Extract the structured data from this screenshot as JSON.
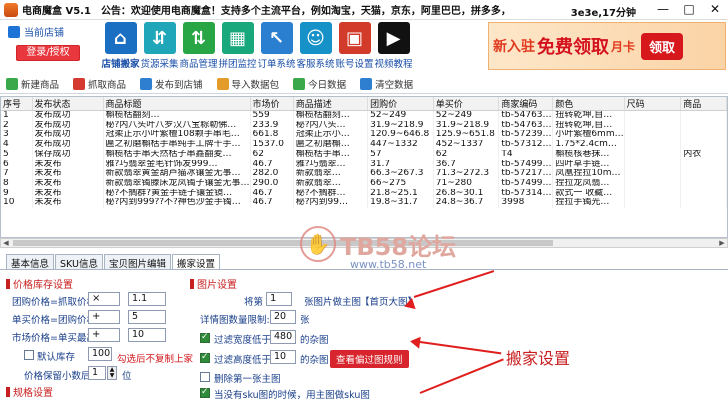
{
  "window": {
    "title": "电商魔盒 V5.1",
    "notice": "公告：欢迎使用电商魔盒！支持多个主流平台，例如淘宝，天猫，京东，阿里巴巴，拼多多，",
    "timer": "3e3e,17分钟"
  },
  "store": {
    "label": "当前店铺",
    "login": "登录/授权"
  },
  "nav": [
    {
      "label": "店铺搬家",
      "color": "#1a6fc3",
      "glyph": "⌂"
    },
    {
      "label": "货源采集",
      "color": "#1fa6b8",
      "glyph": "⇵"
    },
    {
      "label": "商品管理",
      "color": "#28a645",
      "glyph": "⇅"
    },
    {
      "label": "拼团监控",
      "color": "#19a77c",
      "glyph": "▦"
    },
    {
      "label": "订单系统",
      "color": "#2b7fd1",
      "glyph": "↖"
    },
    {
      "label": "客服系统",
      "color": "#1792c8",
      "glyph": "☺"
    },
    {
      "label": "账号设置",
      "color": "#d23a2a",
      "glyph": "▣"
    },
    {
      "label": "视频教程",
      "color": "#111111",
      "glyph": "▶"
    }
  ],
  "banner": {
    "t1": "新入驻",
    "t2": "免费领取",
    "t3": "月卡",
    "btn": "领取"
  },
  "toolbar": [
    {
      "label": "新建商品",
      "color": "#3aa84b"
    },
    {
      "label": "抓取商品",
      "color": "#d43a2f"
    },
    {
      "label": "发布到店铺",
      "color": "#2f7fd0"
    },
    {
      "label": "导入数据包",
      "color": "#e39b2a"
    },
    {
      "label": "今日数据",
      "color": "#3aa84b"
    },
    {
      "label": "清空数据",
      "color": "#2f7fd0"
    }
  ],
  "table": {
    "headers": [
      "序号",
      "发布状态",
      "商品标题",
      "市场价",
      "商品描述",
      "团购价",
      "单买价",
      "商家编码",
      "颜色",
      "尺码",
      "商品"
    ],
    "rows": [
      [
        "1",
        "发布成功",
        "槲榄栝翻刻…",
        "559",
        "槲榄栝翻刻…",
        "52~249",
        "52~249",
        "tb-54763…",
        "扭转乾坤,自…",
        "",
        ""
      ],
      [
        "2",
        "发布成功",
        "秘?内八头叶八罗汉八宝粽勒佛…",
        "233.9",
        "秘?内八头…",
        "31.9~218.9",
        "31.9~218.9",
        "tb-54763…",
        "扭转乾坤,自…",
        "",
        ""
      ],
      [
        "3",
        "发布成功",
        "冠柔正示小叶紫檀108颗手串毛…",
        "661.8",
        "冠柔正示小…",
        "120.9~646.8",
        "125.9~651.8",
        "tb-57239…",
        "小叶紫檀6mm…",
        "",
        ""
      ],
      [
        "4",
        "发布成功",
        "匾之初磨槲栝手串纯手工牌十手…",
        "1537.0",
        "匾之初磨槲…",
        "447~1332",
        "452~1337",
        "tb-57312…",
        "1.75*2.4cm…",
        "",
        ""
      ],
      [
        "5",
        "保存成功",
        "槲榄栝手串天然栝子串鑫翻麦…",
        "62",
        "槲榄栝手串…",
        "57",
        "62",
        "T4",
        "槲榄核巷抹…",
        "",
        "内衣"
      ],
      [
        "6",
        "未发布",
        "雅?巧翡翠金毛针饰发999…",
        "46.7",
        "雅?巧翡翠…",
        "31.7",
        "36.7",
        "tb-57499…",
        "四叶草手链…",
        "",
        ""
      ],
      [
        "7",
        "未发布",
        "新款翡翠黄金葫芦猫冰镶金无事…",
        "282.0",
        "新款翡翠…",
        "66.3~267.3",
        "71.3~272.3",
        "tb-57217…",
        "凤凰捏拉10m…",
        "",
        ""
      ],
      [
        "8",
        "未发布",
        "新款翡翠镯滕床龙凤镯子镶金无事…",
        "290.0",
        "新款翡翠…",
        "66~275",
        "71~280",
        "tb-57499…",
        "捏拉龙凤翡…",
        "",
        ""
      ],
      [
        "9",
        "未发布",
        "秘?不搁群?黄金手链子镶金镜…",
        "46.7",
        "秘?不搁群…",
        "21.8~25.1",
        "26.8~30.1",
        "tb-57314…",
        "款式一 收藏…",
        "",
        ""
      ],
      [
        "10",
        "未发布",
        "秘?内到999??不?神色沙金手镯…",
        "46.7",
        "秘?内到99…",
        "19.8~31.7",
        "24.8~36.7",
        "3998",
        "捏拉手镯光…",
        "",
        ""
      ]
    ]
  },
  "tabs": [
    "基本信息",
    "SKU信息",
    "宝贝图片编辑",
    "搬家设置"
  ],
  "settings": {
    "price_section": "价格库存设置",
    "group_label": "团购价格=抓取价格",
    "group_op": "×",
    "group_val": "1.1",
    "single_label": "单买价格=团购价格",
    "single_op": "+",
    "single_val": "5",
    "market_label": "市场价格=单买最高",
    "market_op": "+",
    "market_val": "10",
    "default_stock_label": "默认库存",
    "default_stock_val": "100",
    "stock_note": "勾选后不复制上家",
    "decimal_label": "价格保留小数后",
    "decimal_val": "1",
    "decimal_unit": "位",
    "spec_section": "规格设置",
    "image_section": "图片设置",
    "main_prefix": "将第",
    "main_val": "1",
    "main_suffix": "张图片做主图",
    "main_link": "【首页大图】",
    "detail_label": "详情图数量限制:",
    "detail_val": "20",
    "detail_unit": "张",
    "filter_w_label": "过滤宽度低于",
    "filter_w_val": "480",
    "filter_w_unit": "的杂图",
    "filter_h_label": "过滤高度低于",
    "filter_h_val": "10",
    "filter_h_unit": "的杂图",
    "view_btn": "查看偏过图规则",
    "delete_first_label": "删除第一张主图",
    "sku_img_label": "当没有sku图的时候，用主图做sku图"
  },
  "watermark": {
    "t1": "TB58论坛",
    "t2": "www.tb58.net"
  },
  "callout": "搬家设置"
}
